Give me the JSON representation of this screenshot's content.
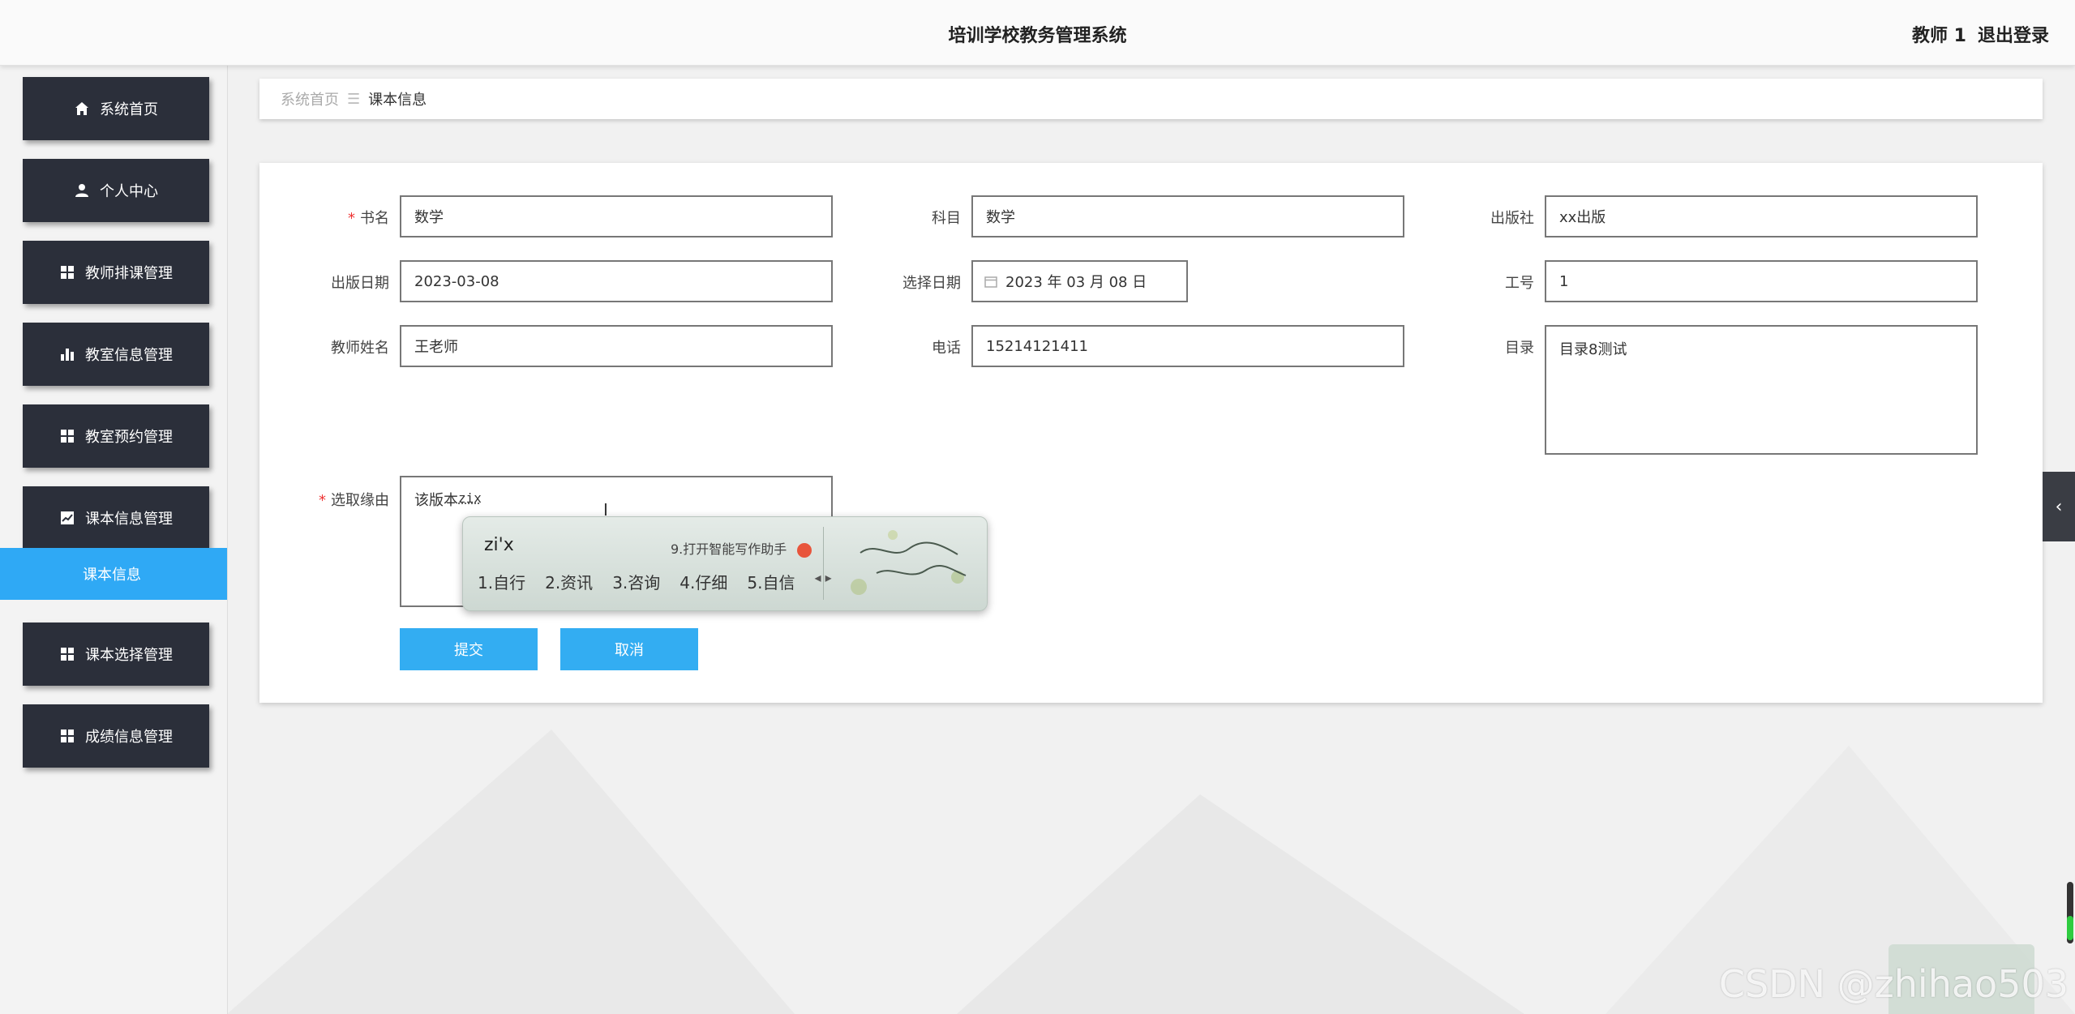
{
  "header": {
    "title": "培训学校教务管理系统",
    "user": "教师 1",
    "logout": "退出登录"
  },
  "sidebar": {
    "items": [
      {
        "label": "系统首页",
        "icon": "home-icon"
      },
      {
        "label": "个人中心",
        "icon": "user-icon"
      },
      {
        "label": "教师排课管理",
        "icon": "grid-icon"
      },
      {
        "label": "教室信息管理",
        "icon": "bar-chart-icon"
      },
      {
        "label": "教室预约管理",
        "icon": "grid-icon"
      },
      {
        "label": "课本信息管理",
        "icon": "line-chart-icon"
      },
      {
        "label": "课本选择管理",
        "icon": "grid-icon"
      },
      {
        "label": "成绩信息管理",
        "icon": "grid-icon"
      }
    ],
    "active_sub": "课本信息",
    "active_color": "#2fa9f5"
  },
  "breadcrumb": {
    "home": "系统首页",
    "separator": "☰",
    "current": "课本信息"
  },
  "form": {
    "book_name": {
      "label": "书名",
      "value": "数学",
      "required": "*"
    },
    "subject": {
      "label": "科目",
      "value": "数学"
    },
    "publisher": {
      "label": "出版社",
      "value": "xx出版"
    },
    "publish_date": {
      "label": "出版日期",
      "value": "2023-03-08"
    },
    "select_date": {
      "label": "选择日期",
      "value": "2023 年 03 月 08 日"
    },
    "staff_no": {
      "label": "工号",
      "value": "1"
    },
    "teacher_name": {
      "label": "教师姓名",
      "value": "王老师"
    },
    "phone": {
      "label": "电话",
      "value": "15214121411"
    },
    "catalog": {
      "label": "目录",
      "value": "目录8测试"
    },
    "reason": {
      "label": "选取缘由",
      "value": "该版本",
      "composing": "zix",
      "required": "*"
    },
    "submit": "提交",
    "cancel": "取消"
  },
  "ime": {
    "composition": "zi'x",
    "hint": "9.打开智能写作助手",
    "candidates": [
      "1.自行",
      "2.资讯",
      "3.咨询",
      "4.仔细",
      "5.自信"
    ]
  },
  "watermark": "CSDN @zhihao503",
  "colors": {
    "nav_bg": "#2b2f3a",
    "button": "#33adf2"
  }
}
